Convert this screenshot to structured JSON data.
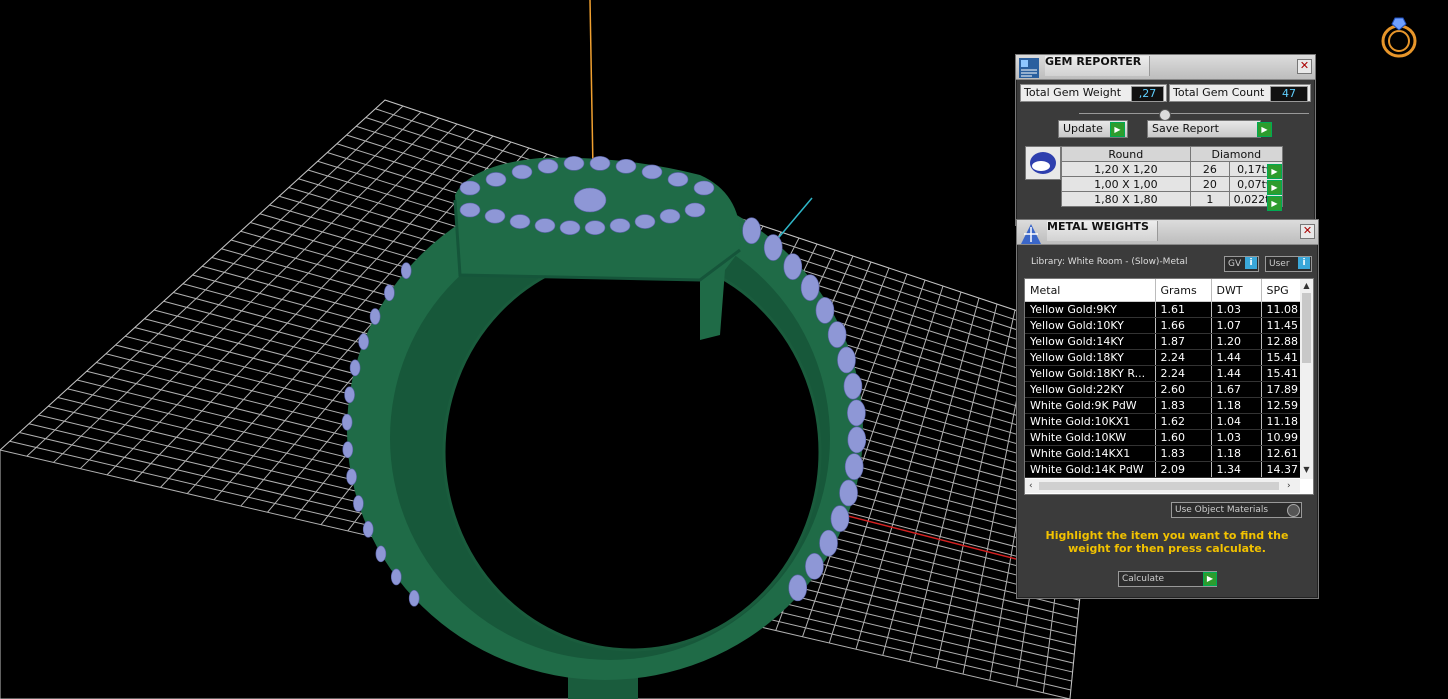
{
  "gem_reporter": {
    "title": "GEM REPORTER",
    "close_glyph": "✕",
    "total_weight_label": "Total Gem Weight",
    "total_weight_value": ",27",
    "total_count_label": "Total Gem Count",
    "total_count_value": "47",
    "update_label": "Update",
    "save_report_label": "Save Report",
    "shape_header": "Round",
    "stone_header": "Diamond",
    "gems": [
      {
        "size": "1,20 X 1,20",
        "count": "26",
        "weight": "0,17tw"
      },
      {
        "size": "1,00 X 1,00",
        "count": "20",
        "weight": "0,07tw"
      },
      {
        "size": "1,80 X 1,80",
        "count": "1",
        "weight": "0,022tw"
      }
    ]
  },
  "metal_weights": {
    "title": "METAL WEIGHTS",
    "close_glyph": "✕",
    "library_label": "Library: White Room - (Slow)-Metal",
    "gv_label": "GV",
    "user_label": "User",
    "columns": [
      "Metal",
      "Grams",
      "DWT",
      "SPG"
    ],
    "rows": [
      [
        "Yellow Gold:9KY",
        "1.61",
        "1.03",
        "11.08"
      ],
      [
        "Yellow Gold:10KY",
        "1.66",
        "1.07",
        "11.45"
      ],
      [
        "Yellow Gold:14KY",
        "1.87",
        "1.20",
        "12.88"
      ],
      [
        "Yellow Gold:18KY",
        "2.24",
        "1.44",
        "15.41"
      ],
      [
        "Yellow Gold:18KY R...",
        "2.24",
        "1.44",
        "15.41"
      ],
      [
        "Yellow Gold:22KY",
        "2.60",
        "1.67",
        "17.89"
      ],
      [
        "White Gold:9K PdW",
        "1.83",
        "1.18",
        "12.59"
      ],
      [
        "White Gold:10KX1",
        "1.62",
        "1.04",
        "11.18"
      ],
      [
        "White Gold:10KW",
        "1.60",
        "1.03",
        "10.99"
      ],
      [
        "White Gold:14KX1",
        "1.83",
        "1.18",
        "12.61"
      ],
      [
        "White Gold:14K PdW",
        "2.09",
        "1.34",
        "14.37"
      ]
    ],
    "use_object_materials_label": "Use Object Materials",
    "hint_text": "Highlight the item you want to find the weight for then press calculate.",
    "calculate_label": "Calculate"
  },
  "colors": {
    "ring_metal": "#1f6b47",
    "gem": "#8e97d6",
    "hint": "#f2c200"
  },
  "icons": {
    "logo": "ring-logo-icon",
    "gem_reporter": "gem-report-icon",
    "metal_weights": "scale-icon"
  }
}
